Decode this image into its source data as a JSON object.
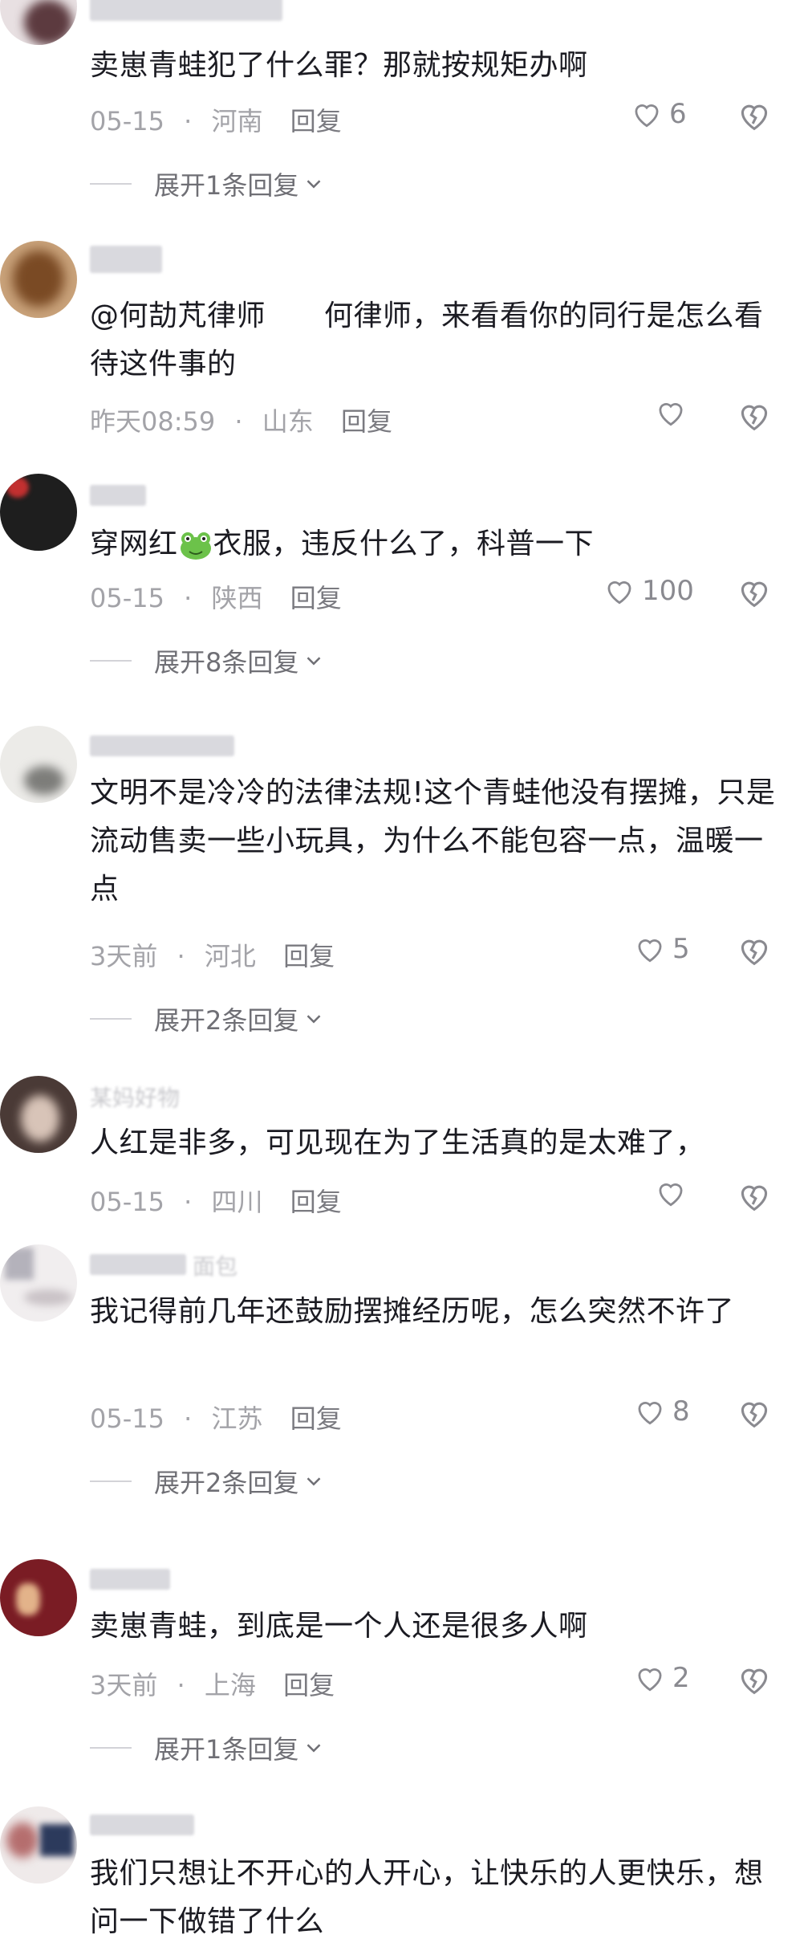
{
  "comments": [
    {
      "text": "卖崽青蛙犯了什么罪？那就按规矩办啊",
      "time": "05-15",
      "region": "河南",
      "reply": "回复",
      "likes": "6",
      "expand": "展开1条回复"
    },
    {
      "text": "@何劼芃律师　　何律师，来看看你的同行是怎么看待这件事的",
      "time": "昨天08:59",
      "region": "山东",
      "reply": "回复",
      "likes": ""
    },
    {
      "text_before": "穿网红",
      "text_after": "衣服，违反什么了，科普一下",
      "time": "05-15",
      "region": "陕西",
      "reply": "回复",
      "likes": "100",
      "expand": "展开8条回复"
    },
    {
      "text": "文明不是冷冷的法律法规!这个青蛙他没有摆摊，只是流动售卖一些小玩具，为什么不能包容一点，温暖一点",
      "time": "3天前",
      "region": "河北",
      "reply": "回复",
      "likes": "5",
      "expand": "展开2条回复"
    },
    {
      "username": "某妈好物",
      "text": "人红是非多，可见现在为了生活真的是太难了，",
      "time": "05-15",
      "region": "四川",
      "reply": "回复",
      "likes": ""
    },
    {
      "username": "面包",
      "text": "我记得前几年还鼓励摆摊经历呢，怎么突然不许了",
      "time": "05-15",
      "region": "江苏",
      "reply": "回复",
      "likes": "8",
      "expand": "展开2条回复"
    },
    {
      "text": "卖崽青蛙，到底是一个人还是很多人啊",
      "time": "3天前",
      "region": "上海",
      "reply": "回复",
      "likes": "2",
      "expand": "展开1条回复"
    },
    {
      "text": "我们只想让不开心的人开心，让快乐的人更快乐，想问一下做错了什么"
    }
  ],
  "separator": "·",
  "icons": {
    "like": "heart-outline-icon",
    "dislike": "broken-heart-icon",
    "expand": "chevron-down-icon",
    "emoji": "frog-emoji-icon"
  },
  "colors": {
    "text": "#1b1b22",
    "meta": "#a3a3a8",
    "icon": "#8a8a90"
  }
}
